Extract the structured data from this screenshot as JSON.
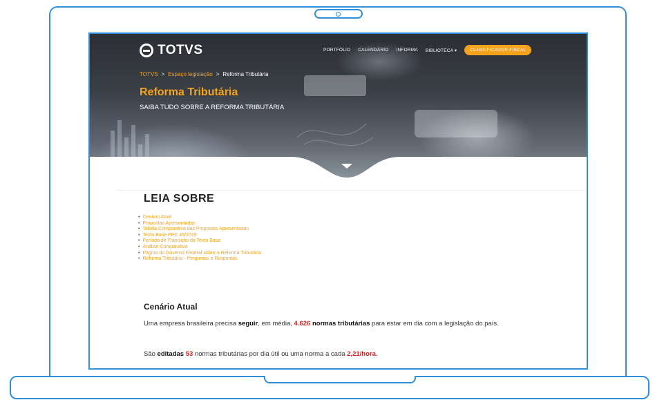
{
  "site": {
    "logo_text": "TOTVS",
    "nav": [
      "PORTFÓLIO",
      "CALENDÁRIO",
      "INFORMA",
      "BIBLIOTECA ▾"
    ],
    "cta": "CLASSIFICADOR FISCAL"
  },
  "breadcrumb": {
    "items": [
      "TOTVS",
      "Espaço legislação",
      "Reforma Tributária"
    ],
    "separator": ">"
  },
  "hero": {
    "title": "Reforma Tributária",
    "subtitle": "SAIBA TUDO SOBRE A REFORMA TRIBUTÁRIA"
  },
  "main": {
    "section_heading": "LEIA SOBRE",
    "links": [
      "Cenário Atual",
      "Propostas Apresentadas",
      "Tabela Comparativa das Propostas Apresentadas",
      "Texto Base PEC 45/2019",
      "Período de Transição do Texto Base",
      "Análise Comparativa",
      "Página do Governo Federal sobre a Reforma Tributária",
      "Reforma Tributária - Perguntas e Respostas"
    ],
    "sub_heading": "Cenário Atual",
    "paragraph1": {
      "part1": "Uma empresa brasileira precisa ",
      "bold1": "seguir",
      "part2": ", em média, ",
      "red1": "4.626",
      "bold2": " normas tributárias",
      "part3": " para estar em dia com a legislação do país."
    },
    "paragraph2": {
      "part1": "São ",
      "bold1": "editadas",
      "red1": " 53",
      "part2": " normas tributárias por dia útil ou uma norma a cada ",
      "red2": "2,21/hora."
    }
  },
  "colors": {
    "accent_orange": "#f5a21c",
    "frame_blue": "#2f8fd8",
    "highlight_red": "#d81e1e"
  }
}
